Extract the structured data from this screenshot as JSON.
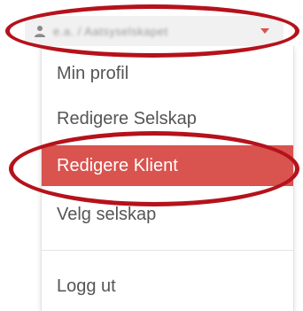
{
  "user_menu": {
    "toggle_label": "e.a. / Aatsyselskapet",
    "icon": "user-icon",
    "caret_icon": "caret-down-icon",
    "caret_color": "#d9534f"
  },
  "menu": {
    "items": [
      {
        "label": "Min profil"
      },
      {
        "label": "Redigere Selskap"
      },
      {
        "label": "Redigere Klient",
        "active": true
      },
      {
        "label": "Velg selskap"
      },
      {
        "label": "Logg ut"
      }
    ],
    "active_color": "#d9534f"
  },
  "annotations": {
    "ellipse_color": "#b5121b"
  }
}
